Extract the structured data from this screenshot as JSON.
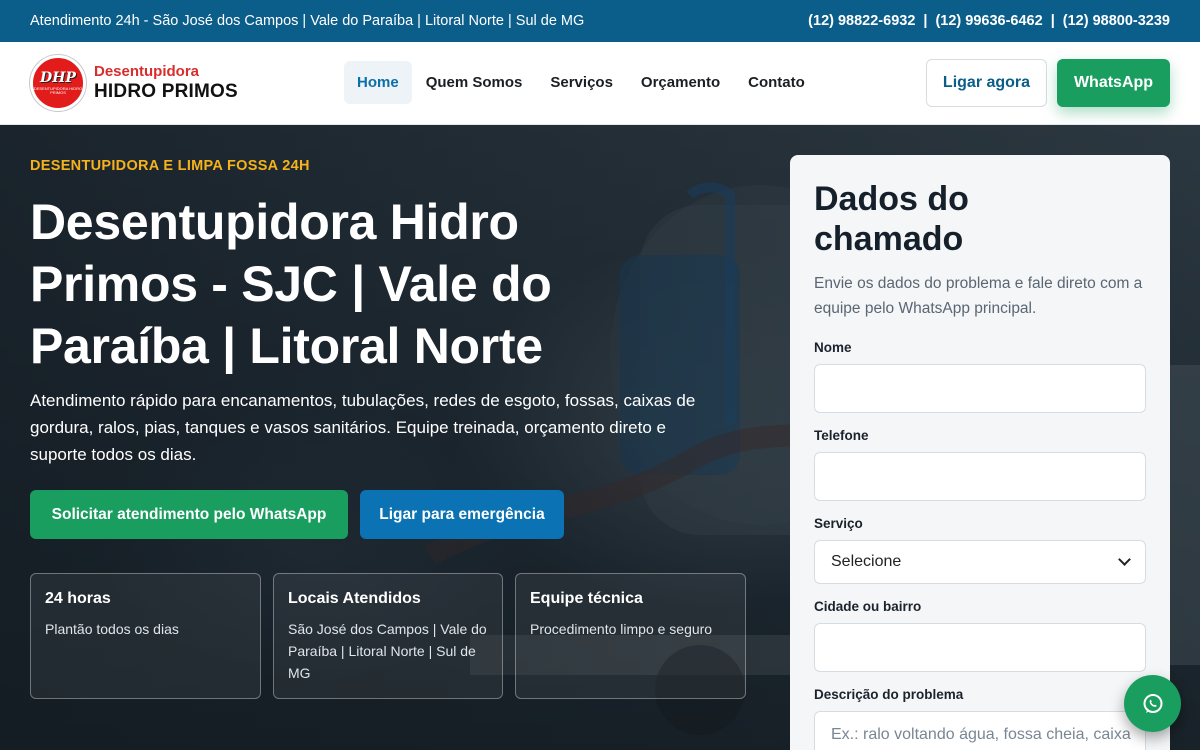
{
  "topbar": {
    "info": "Atendimento 24h - São José dos Campos | Vale do Paraíba | Litoral Norte | Sul de MG",
    "phones": [
      "(12) 98822-6932",
      "(12) 99636-6462",
      "(12) 98800-3239"
    ],
    "separator": "|"
  },
  "brand": {
    "logo_abbr": "DHP",
    "logo_small": "DESENTUPIDORA HIDRO PRIMOS",
    "line1": "Desentupidora",
    "line2": "HIDRO PRIMOS"
  },
  "nav": {
    "items": [
      "Home",
      "Quem Somos",
      "Serviços",
      "Orçamento",
      "Contato"
    ],
    "active": "Home"
  },
  "header_buttons": {
    "call": "Ligar agora",
    "whatsapp": "WhatsApp"
  },
  "hero": {
    "eyebrow": "DESENTUPIDORA E LIMPA FOSSA 24H",
    "title": "Desentupidora Hidro Primos - SJC | Vale do Paraíba | Litoral Norte",
    "description": "Atendimento rápido para encanamentos, tubulações, redes de esgoto, fossas, caixas de gordura, ralos, pias, tanques e vasos sanitários. Equipe treinada, orçamento direto e suporte todos os dias.",
    "cta_primary": "Solicitar atendimento pelo WhatsApp",
    "cta_secondary": "Ligar para emergência",
    "cards": [
      {
        "title": "24 horas",
        "text": "Plantão todos os dias"
      },
      {
        "title": "Locais Atendidos",
        "text": "São José dos Campos | Vale do Paraíba | Litoral Norte | Sul de MG"
      },
      {
        "title": "Equipe técnica",
        "text": "Procedimento limpo e seguro"
      }
    ]
  },
  "form": {
    "title": "Dados do chamado",
    "intro": "Envie os dados do problema e fale direto com a equipe pelo WhatsApp principal.",
    "name_label": "Nome",
    "name_value": "",
    "phone_label": "Telefone",
    "phone_value": "",
    "service_label": "Serviço",
    "service_selected": "Selecione",
    "city_label": "Cidade ou bairro",
    "city_value": "",
    "description_label": "Descrição do problema",
    "description_placeholder": "Ex.: ralo voltando água, fossa cheia, caixa"
  },
  "colors": {
    "topbar": "#0b5d8a",
    "whatsapp_green": "#1a9e5f",
    "call_blue": "#0b72b3",
    "eyebrow_yellow": "#f5b21b",
    "logo_red": "#e21b1b"
  },
  "icons": {
    "floating": "whatsapp-icon",
    "select": "chevron-down-icon"
  }
}
